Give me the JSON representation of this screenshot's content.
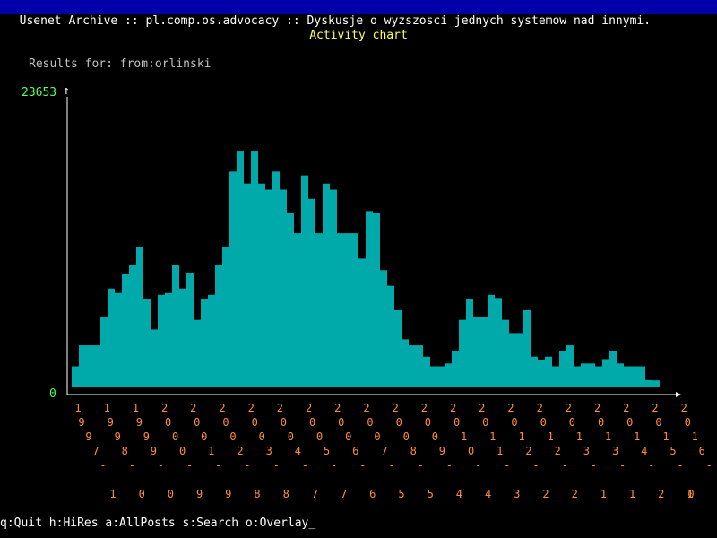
{
  "window": {
    "title": "Usenet Archive :: pl.comp.os.advocacy :: Dyskusje o wyzszosci jednych systemow nad innymi."
  },
  "header": {
    "chart_title": "Activity chart",
    "results_label": "Results for: from:orlinski"
  },
  "colors": {
    "titlebar_bg": "#0000aa",
    "all_posts": "#00aaaa",
    "overlay": "#aa0000",
    "axis": "#ffffff",
    "tick_labels": "#ff8c3a",
    "ymax_label": "#55ff55"
  },
  "chart_data": {
    "type": "bar",
    "ylim": [
      0,
      23653
    ],
    "y_labels": {
      "max": "23653",
      "min": "0"
    },
    "x_tick_columns": [
      {
        "lines": [
          "1",
          "9",
          "9",
          "7",
          "-",
          "1"
        ]
      },
      {
        "lines": [
          "1",
          "9",
          "9",
          "8",
          "-",
          "0"
        ]
      },
      {
        "lines": [
          "1",
          "9",
          "9",
          "9",
          "-",
          "0"
        ]
      },
      {
        "lines": [
          "2",
          "0",
          "0",
          "0",
          "-",
          "9"
        ]
      },
      {
        "lines": [
          "2",
          "0",
          "0",
          "1",
          "-",
          "9"
        ]
      },
      {
        "lines": [
          "2",
          "0",
          "0",
          "2",
          "-",
          "8"
        ]
      },
      {
        "lines": [
          "2",
          "0",
          "0",
          "3",
          "-",
          "8"
        ]
      },
      {
        "lines": [
          "2",
          "0",
          "0",
          "4",
          "-",
          "7"
        ]
      },
      {
        "lines": [
          "2",
          "0",
          "0",
          "5",
          "-",
          "7"
        ]
      },
      {
        "lines": [
          "2",
          "0",
          "0",
          "6",
          "-",
          "6"
        ]
      },
      {
        "lines": [
          "2",
          "0",
          "0",
          "7",
          "-",
          "5"
        ]
      },
      {
        "lines": [
          "2",
          "0",
          "0",
          "8",
          "-",
          "5"
        ]
      },
      {
        "lines": [
          "2",
          "0",
          "0",
          "9",
          "-",
          "4"
        ]
      },
      {
        "lines": [
          "2",
          "0",
          "1",
          "0",
          "-",
          "4"
        ]
      },
      {
        "lines": [
          "2",
          "0",
          "1",
          "1",
          "-",
          "3"
        ]
      },
      {
        "lines": [
          "2",
          "0",
          "1",
          "2",
          "-",
          "2"
        ]
      },
      {
        "lines": [
          "2",
          "0",
          "1",
          "2",
          "-",
          "2"
        ]
      },
      {
        "lines": [
          "2",
          "0",
          "1",
          "3",
          "-",
          "1"
        ]
      },
      {
        "lines": [
          "2",
          "0",
          "1",
          "3",
          "-",
          "1"
        ]
      },
      {
        "lines": [
          "2",
          "0",
          "1",
          "4",
          "-",
          "2"
        ]
      },
      {
        "lines": [
          "2",
          "0",
          "1",
          "5",
          "-",
          "1"
        ]
      },
      {
        "lines": [
          "2",
          "0",
          "1",
          "6",
          "-",
          "1"
        ]
      },
      {
        "lines": [
          "",
          "",
          "",
          "",
          "",
          "0"
        ]
      }
    ],
    "series": [
      {
        "values": [
          1652,
          3304,
          3304,
          3304,
          5544,
          7760,
          7408,
          8872,
          9632,
          11014,
          6912,
          4546,
          7264,
          7408,
          9632,
          7760,
          8988,
          5304,
          6912,
          7264,
          9632,
          11014,
          16940,
          18580,
          16000,
          18580,
          16000,
          15520,
          16940,
          15520,
          13680,
          12100,
          16640,
          14800,
          12100,
          16000,
          15520,
          12100,
          12100,
          12100,
          10112,
          13840,
          13680,
          9200,
          7976,
          6060,
          3776,
          3304,
          3304,
          2412,
          1652,
          1652,
          1878,
          2888,
          5304,
          6912,
          5544,
          5544,
          7264,
          7016,
          5304,
          4264,
          4266,
          6060,
          2412,
          2160,
          2412,
          1652,
          2888,
          3304,
          1652,
          1878,
          1878,
          1652,
          2222,
          2888,
          1878,
          1652,
          1652,
          1652,
          570,
          550
        ]
      },
      {
        "values": [
          0,
          0,
          0,
          0,
          0,
          0,
          0,
          0,
          0,
          0,
          0,
          0,
          0,
          0,
          0,
          0,
          0,
          0,
          0,
          0,
          0,
          0,
          0,
          0,
          0,
          0,
          0,
          0,
          0,
          0,
          0,
          0,
          0,
          0,
          0,
          0,
          0,
          0,
          0,
          0,
          0,
          0,
          0,
          0,
          0,
          0,
          0,
          0,
          0,
          0,
          0,
          0,
          0,
          0,
          0,
          0,
          0,
          0,
          0,
          0,
          0,
          0,
          0,
          0,
          0,
          0,
          0,
          0,
          0,
          0,
          0,
          0,
          0,
          0,
          0,
          0,
          0,
          0,
          0,
          0,
          0,
          0
        ]
      }
    ]
  },
  "footer": {
    "command_line": "q:Quit h:HiRes a:AllPosts s:Search o:Overlay",
    "cursor": "_"
  }
}
